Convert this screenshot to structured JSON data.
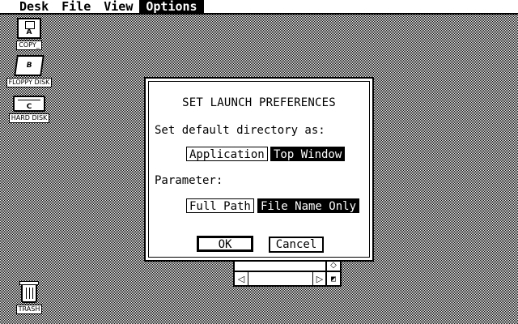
{
  "menubar": {
    "items": [
      {
        "label": "Desk",
        "active": false
      },
      {
        "label": "File",
        "active": false
      },
      {
        "label": "View",
        "active": false
      },
      {
        "label": "Options",
        "active": true
      }
    ]
  },
  "desktop": {
    "icons": [
      {
        "name": "floppy-disk-a",
        "label": "COPY_",
        "letter": "A",
        "icon": "floppy-drive-icon"
      },
      {
        "name": "floppy-disk-b",
        "label": "FLOPPY DISK",
        "letter": "B",
        "icon": "floppy-drive-icon"
      },
      {
        "name": "hard-disk-c",
        "label": "HARD DISK",
        "letter": "C",
        "icon": "hard-disk-icon"
      },
      {
        "name": "trash",
        "label": "TRASH",
        "icon": "trash-can-icon"
      }
    ]
  },
  "dialog": {
    "title": "SET LAUNCH PREFERENCES",
    "directory_label": "Set default directory as:",
    "directory_options": [
      "Application",
      "Top Window"
    ],
    "directory_selected": "Top Window",
    "parameter_label": "Parameter:",
    "parameter_options": [
      "Full Path",
      "File Name Only"
    ],
    "parameter_selected": "File Name Only",
    "ok_label": "OK",
    "cancel_label": "Cancel"
  },
  "colors": {
    "foreground": "#000000",
    "background": "#ffffff"
  }
}
